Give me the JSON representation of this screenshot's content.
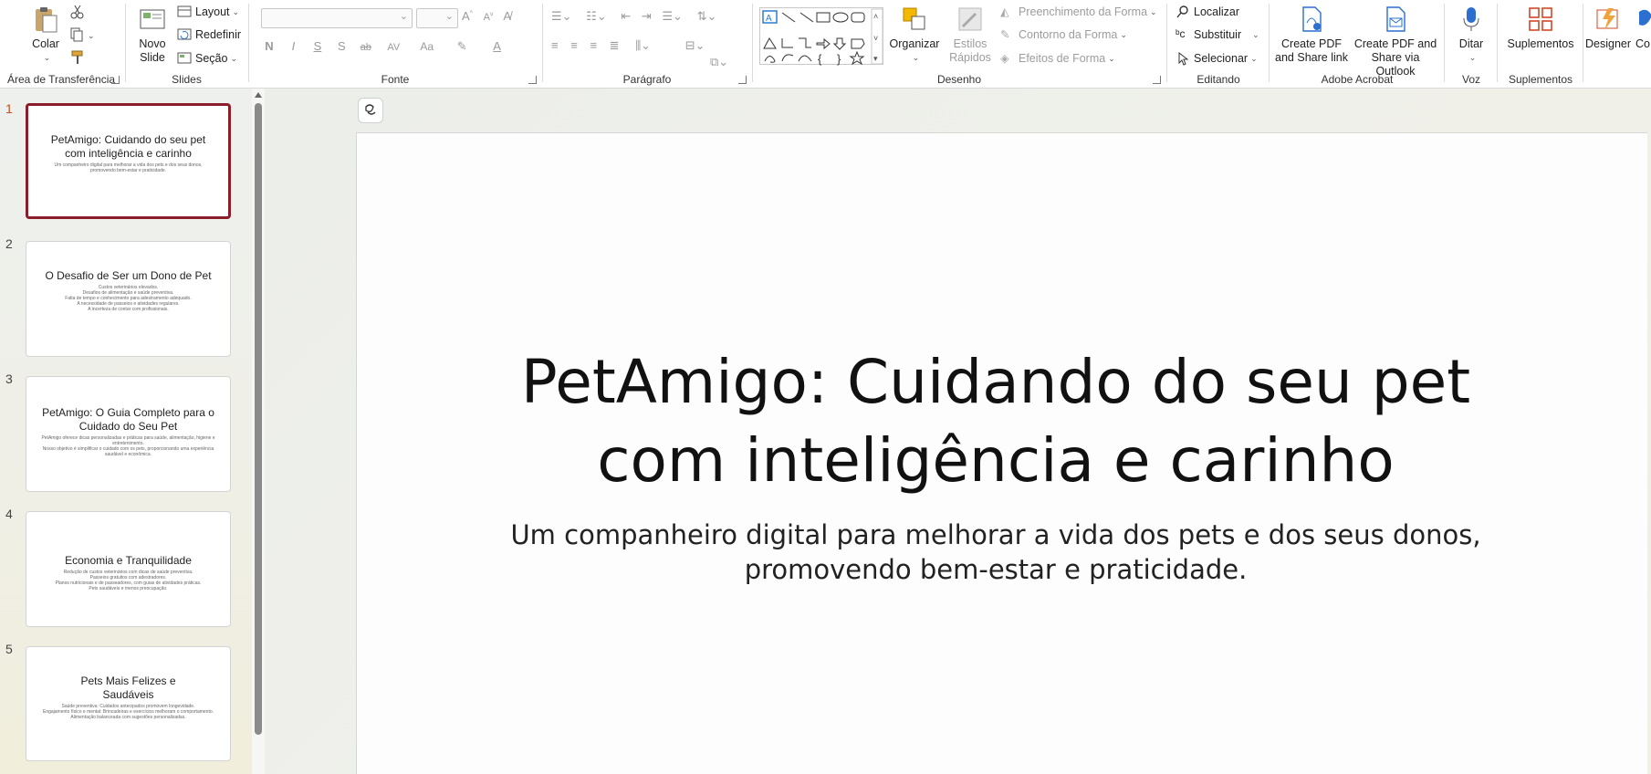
{
  "ribbon": {
    "clipboard": {
      "paste": "Colar",
      "group": "Área de Transferência"
    },
    "slides": {
      "new_slide": "Novo Slide",
      "layout": "Layout",
      "reset": "Redefinir",
      "section": "Seção",
      "group": "Slides"
    },
    "font": {
      "bold": "N",
      "italic": "I",
      "underline": "S",
      "shadow": "S",
      "strike": "ab",
      "spacing": "AV",
      "case": "Aa",
      "group": "Fonte"
    },
    "paragraph": {
      "group": "Parágrafo"
    },
    "drawing": {
      "arrange": "Organizar",
      "quick_styles": "Estilos Rápidos",
      "shape_fill": "Preenchimento da Forma",
      "shape_outline": "Contorno da Forma",
      "shape_effects": "Efeitos de Forma",
      "group": "Desenho"
    },
    "editing": {
      "find": "Localizar",
      "replace": "Substituir",
      "select": "Selecionar",
      "group": "Editando"
    },
    "acrobat": {
      "create_share_link": "Create PDF and Share link",
      "create_share_outlook": "Create PDF and Share via Outlook",
      "group": "Adobe Acrobat"
    },
    "voice": {
      "dictate": "Ditar",
      "group": "Voz"
    },
    "addins": {
      "addins": "Suplementos",
      "group": "Suplementos"
    },
    "designer": {
      "designer": "Designer",
      "copilot_partial": "Co"
    }
  },
  "thumbnails": [
    {
      "num": "1",
      "title": "PetAmigo: Cuidando do seu pet com inteligência e carinho",
      "body": [
        "Um companheiro digital para melhorar a vida dos pets e dos seus donos, promovendo bem-estar e praticidade."
      ]
    },
    {
      "num": "2",
      "title": "O Desafio de Ser um Dono de Pet",
      "body": [
        "Custos veterinários elevados.",
        "Desafios de alimentação e saúde preventiva.",
        "Falta de tempo e conhecimento para adestramento adequado.",
        "A necessidade de passeios e atividades regulares.",
        "A incerteza de contar com profissionais."
      ]
    },
    {
      "num": "3",
      "title": "PetAmigo: O Guia Completo para o Cuidado do Seu Pet",
      "body": [
        "PetAmigo oferece dicas personalizadas e práticas para saúde, alimentação, higiene e entretenimento.",
        "Nosso objetivo é simplificar o cuidado com os pets, proporcionando uma experiência saudável e econômica."
      ]
    },
    {
      "num": "4",
      "title": "Economia e Tranquilidade",
      "body": [
        "Redução de custos veterinários com dicas de saúde preventiva.",
        "Passeios gratuitos com adestradores.",
        "Planos nutricionais e de passeadores, com guias de atividades práticas.",
        "Pets saudáveis e menos preocupação."
      ]
    },
    {
      "num": "5",
      "title": "Pets Mais Felizes e Saudáveis",
      "body": [
        "Saúde preventiva: Cuidados antecipados promovem longevidade.",
        "Engajamento físico e mental: Brincadeiras e exercícios melhoram o comportamento.",
        "Alimentação balanceada com sugestões personalizadas."
      ]
    }
  ],
  "slide": {
    "title": "PetAmigo: Cuidando do seu pet com inteligência e carinho",
    "subtitle": "Um companheiro digital para melhorar a vida dos pets e dos seus donos, promovendo bem-estar e praticidade."
  }
}
